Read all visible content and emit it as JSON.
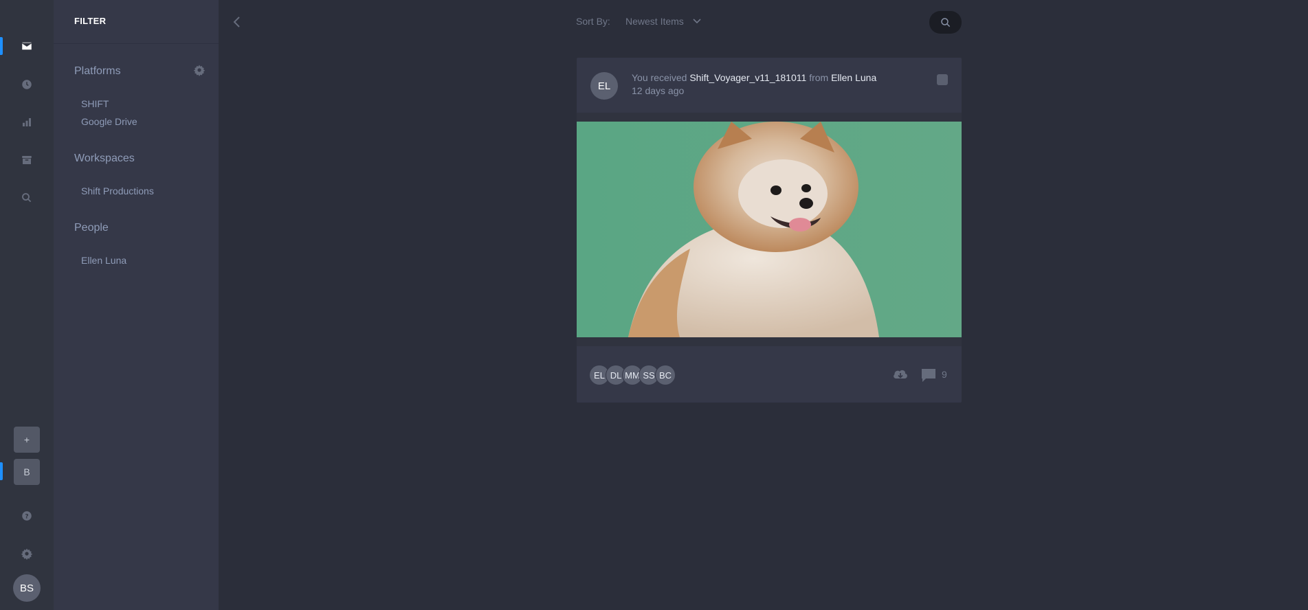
{
  "rail": {
    "items": [
      {
        "icon": "mail-icon",
        "active": true
      },
      {
        "icon": "clock-icon",
        "active": false
      },
      {
        "icon": "bar-chart-icon",
        "active": false
      },
      {
        "icon": "archive-icon",
        "active": false
      },
      {
        "icon": "search-icon",
        "active": false
      }
    ],
    "add_label": "+",
    "workspace_label": "B",
    "help_icon": "help-icon",
    "settings_icon": "gear-icon",
    "user_initials": "BS",
    "accent": "#1e90ff"
  },
  "filter": {
    "title": "FILTER",
    "platforms_label": "Platforms",
    "platforms": [
      "SHIFT",
      "Google Drive"
    ],
    "workspaces_label": "Workspaces",
    "workspaces": [
      "Shift Productions"
    ],
    "people_label": "People",
    "people": [
      "Ellen Luna"
    ]
  },
  "topbar": {
    "sort_label": "Sort By:",
    "sort_value": "Newest Items"
  },
  "card": {
    "avatar": "EL",
    "prefix": "You received",
    "filename": "Shift_Voyager_v11_181011",
    "from_word": "from",
    "sender": "Ellen Luna",
    "time": "12 days ago",
    "viewers": [
      "EL",
      "DL",
      "MM",
      "SS",
      "BC"
    ],
    "comment_count": "9"
  }
}
